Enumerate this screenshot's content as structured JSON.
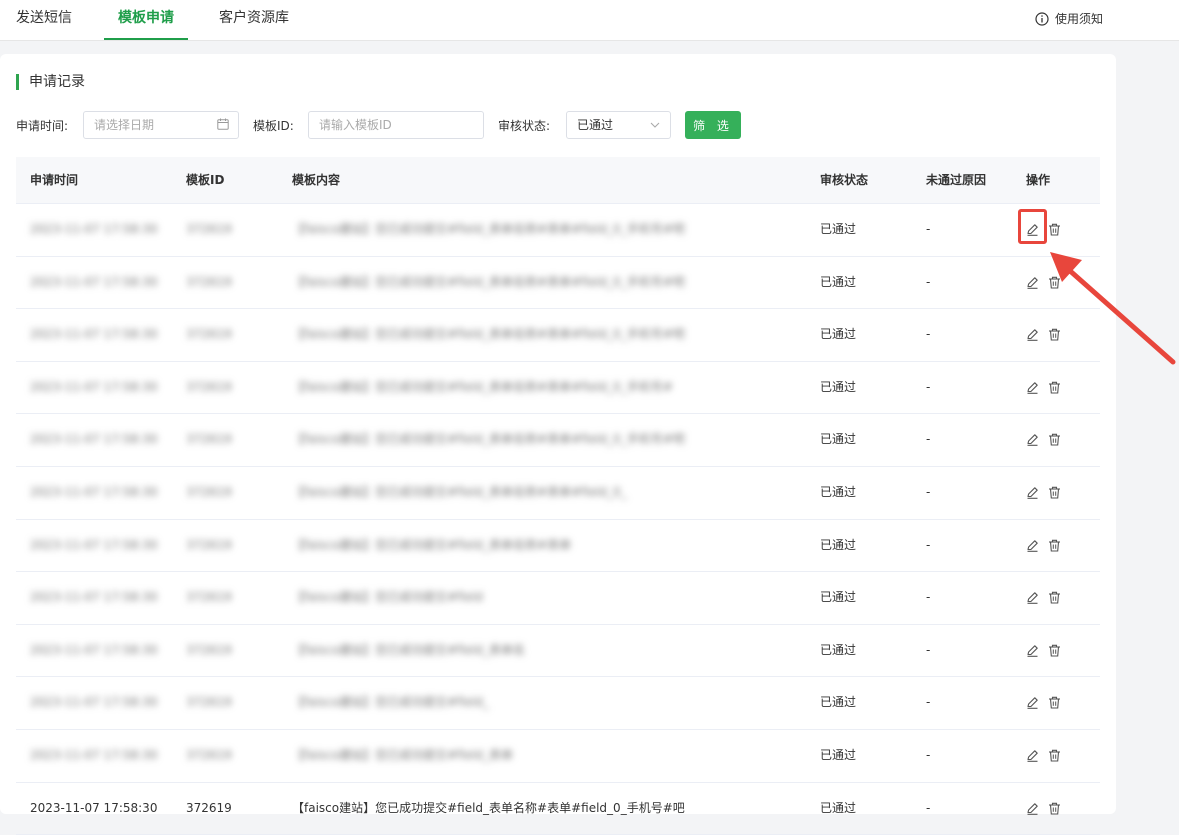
{
  "tabs": [
    {
      "label": "发送短信",
      "active": false
    },
    {
      "label": "模板申请",
      "active": true
    },
    {
      "label": "客户资源库",
      "active": false
    }
  ],
  "help": {
    "label": "使用须知",
    "icon": "info-icon"
  },
  "section": {
    "title": "申请记录"
  },
  "filters": {
    "date_label": "申请时间:",
    "date_placeholder": "请选择日期",
    "id_label": "模板ID:",
    "id_placeholder": "请输入模板ID",
    "status_label": "审核状态:",
    "status_value": "已通过",
    "submit_label": "筛 选"
  },
  "table": {
    "headers": [
      "申请时间",
      "模板ID",
      "模板内容",
      "审核状态",
      "未通过原因",
      "操作"
    ],
    "rows": [
      {
        "time": "2023-11-07 17:58:30",
        "id": "372619",
        "content": "【faisco建站】您已成功提交#field_表单名称#表单#field_0_手机号#吧",
        "status": "已通过",
        "reason": "-"
      },
      {
        "time": "2023-11-07 17:58:30",
        "id": "372619",
        "content": "【faisco建站】您已成功提交#field_表单名称#表单#field_0_手机号#吧",
        "status": "已通过",
        "reason": "-"
      },
      {
        "time": "2023-11-07 17:58:30",
        "id": "372619",
        "content": "【faisco建站】您已成功提交#field_表单名称#表单#field_0_手机号#吧",
        "status": "已通过",
        "reason": "-"
      },
      {
        "time": "2023-11-07 17:58:30",
        "id": "372619",
        "content": "【faisco建站】您已成功提交#field_表单名称#表单#field_0_手机号#",
        "status": "已通过",
        "reason": "-"
      },
      {
        "time": "2023-11-07 17:58:30",
        "id": "372619",
        "content": "【faisco建站】您已成功提交#field_表单名称#表单#field_0_手机号#吧",
        "status": "已通过",
        "reason": "-"
      },
      {
        "time": "2023-11-07 17:58:30",
        "id": "372619",
        "content": "【faisco建站】您已成功提交#field_表单名称#表单#field_0_",
        "status": "已通过",
        "reason": "-"
      },
      {
        "time": "2023-11-07 17:58:30",
        "id": "372619",
        "content": "【faisco建站】您已成功提交#field_表单名称#表单",
        "status": "已通过",
        "reason": "-"
      },
      {
        "time": "2023-11-07 17:58:30",
        "id": "372619",
        "content": "【faisco建站】您已成功提交#field",
        "status": "已通过",
        "reason": "-"
      },
      {
        "time": "2023-11-07 17:58:30",
        "id": "372619",
        "content": "【faisco建站】您已成功提交#field_表单名",
        "status": "已通过",
        "reason": "-"
      },
      {
        "time": "2023-11-07 17:58:30",
        "id": "372619",
        "content": "【faisco建站】您已成功提交#field_",
        "status": "已通过",
        "reason": "-"
      },
      {
        "time": "2023-11-07 17:58:30",
        "id": "372619",
        "content": "【faisco建站】您已成功提交#field_表单",
        "status": "已通过",
        "reason": "-"
      },
      {
        "time": "2023-11-07 17:58:30",
        "id": "372619",
        "content": "【faisco建站】您已成功提交#field_表单名称#表单#field_0_手机号#吧",
        "status": "已通过",
        "reason": "-"
      }
    ],
    "blurred_rows": 11
  },
  "colors": {
    "accent": "#1f9e4a",
    "button": "#35b05a",
    "annotation": "#e8463c"
  }
}
